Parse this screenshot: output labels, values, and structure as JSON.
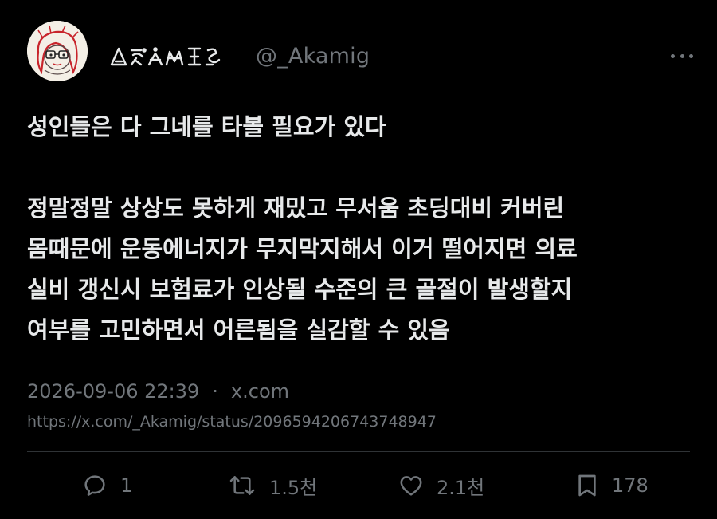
{
  "author": {
    "display_name": "ᐃᕁᐊᙢᕮᖶ",
    "handle": "@_Akamig"
  },
  "tweet": {
    "text": "성인들은 다 그네를 타볼 필요가 있다\n\n정말정말 상상도 못하게 재밌고 무서움 초딩대비 커버린\n몸때문에 운동에너지가 무지막지해서 이거 떨어지면 의료\n실비 갱신시 보험료가 인상될 수준의 큰 골절이 발생할지\n여부를 고민하면서 어른됨을 실감할 수 있음",
    "timestamp": "2026-09-06 22:39",
    "separator": "·",
    "source": "x.com",
    "url": "https://x.com/_Akamig/status/2096594206743748947"
  },
  "actions": {
    "reply": {
      "icon": "reply-icon",
      "count": "1"
    },
    "repost": {
      "icon": "repost-icon",
      "count": "1.5천"
    },
    "like": {
      "icon": "heart-icon",
      "count": "2.1천"
    },
    "bookmark": {
      "icon": "bookmark-icon",
      "count": "178"
    }
  },
  "colors": {
    "background": "#000000",
    "text": "#e7e9ea",
    "muted": "#71767b",
    "divider": "#2f3336",
    "avatar_accent": "#c8242b"
  }
}
